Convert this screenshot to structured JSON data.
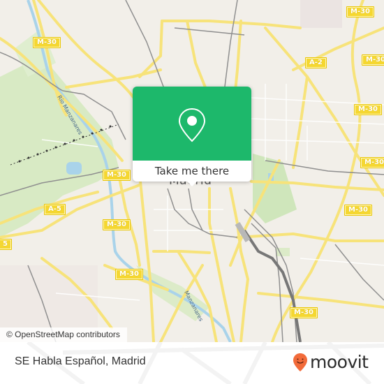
{
  "map": {
    "city_label": "Madrid",
    "river_label": "Río Manzanares",
    "river_label_2": "Manzanares",
    "road_shields": [
      {
        "id": "m30-nw",
        "label": "M-30"
      },
      {
        "id": "m30-ne",
        "label": "M-30"
      },
      {
        "id": "a2",
        "label": "A-2"
      },
      {
        "id": "m30-e1",
        "label": "M-30"
      },
      {
        "id": "m30-e2",
        "label": "M-30"
      },
      {
        "id": "m30-w1",
        "label": "M-30"
      },
      {
        "id": "a5",
        "label": "A-5"
      },
      {
        "id": "a5-edge",
        "label": "5"
      },
      {
        "id": "m30-e3",
        "label": "M-30"
      },
      {
        "id": "m30-w2",
        "label": "M-30"
      },
      {
        "id": "m30-e4",
        "label": "M-30"
      },
      {
        "id": "m30-sw",
        "label": "M-30"
      },
      {
        "id": "m30-se",
        "label": "M-30"
      }
    ],
    "attribution": "© OpenStreetMap contributors",
    "colors": {
      "land": "#f2efe9",
      "park": "#d8eac4",
      "major_road": "#f7e37a",
      "water": "#a9d3ea",
      "rail": "#8f8f8f"
    }
  },
  "popup": {
    "icon": "location-pin-icon",
    "button_label": "Take me there",
    "accent_color": "#1db86b"
  },
  "footer": {
    "place_name": "SE Habla Español, Madrid",
    "logo_text": "moovit",
    "logo_color": "#f26b3a"
  }
}
